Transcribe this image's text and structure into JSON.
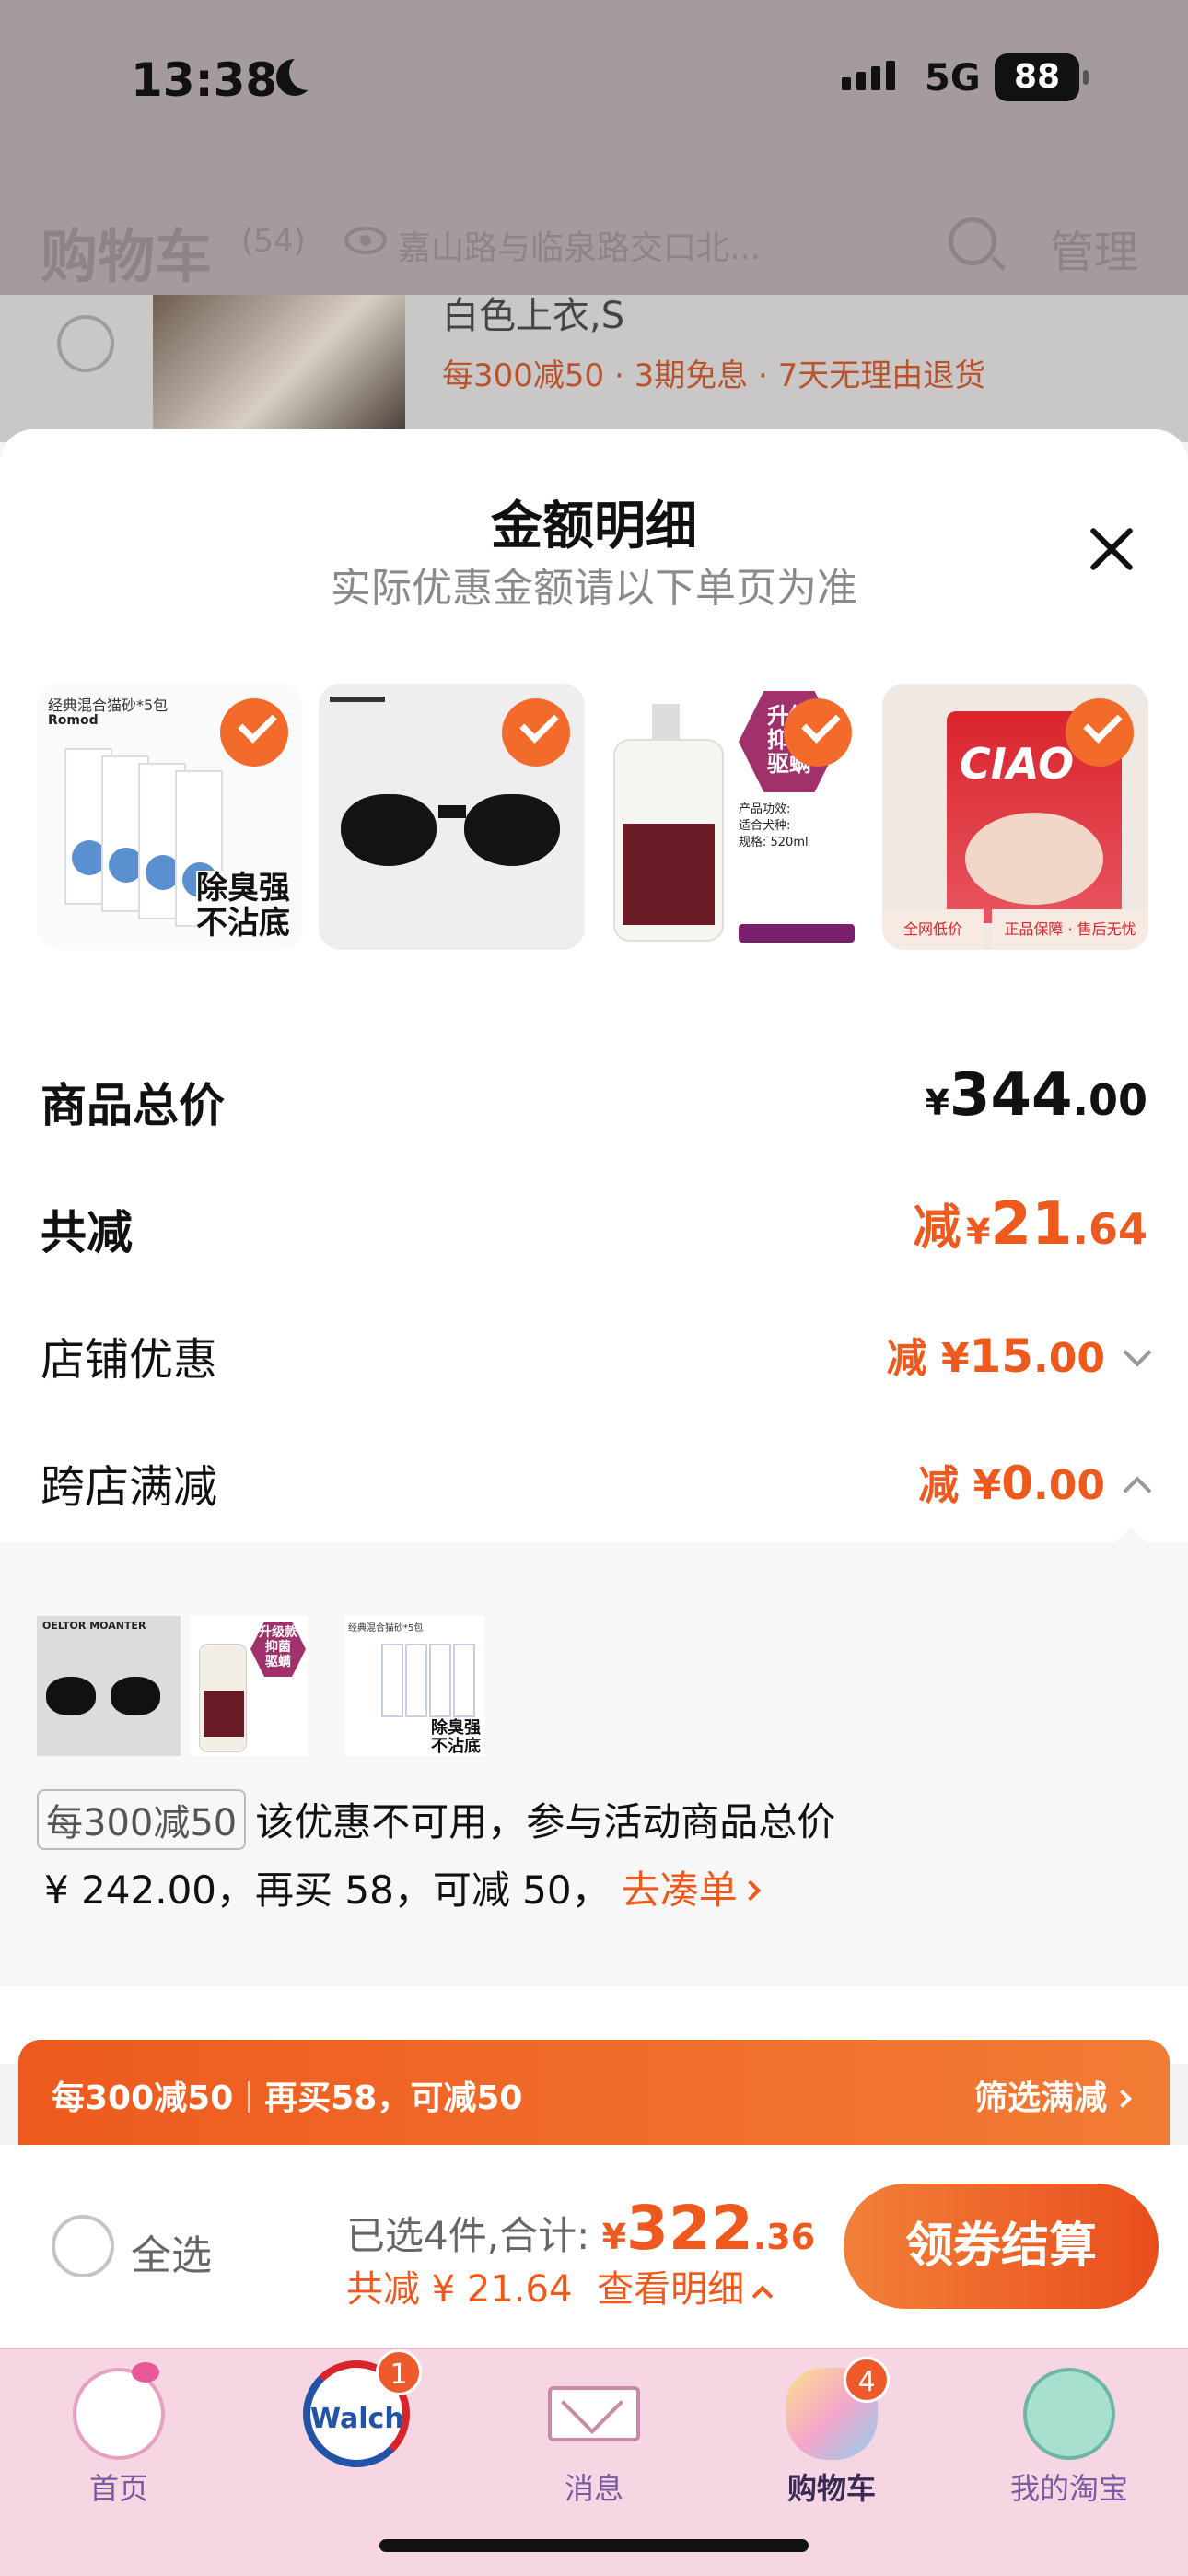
{
  "status_bar": {
    "time": "13:38",
    "network": "5G",
    "battery": "88"
  },
  "cart_header": {
    "title": "购物车",
    "count": "(54)",
    "address": "嘉山路与临泉路交口北...",
    "manage_label": "管理"
  },
  "background_item": {
    "spec": "白色上衣,S",
    "promo": "每300减50 · 3期免息 · 7天无理由退货"
  },
  "sheet": {
    "title": "金额明细",
    "subtitle": "实际优惠金额请以下单页为准",
    "products": [
      {
        "name": "cat-litter",
        "title": "经典混合猫砂*5包",
        "brand": "Romod",
        "label": "除臭强\n不沾底"
      },
      {
        "name": "sunglasses"
      },
      {
        "name": "pet-shampoo",
        "badge": "升级\n抑菌\n驱螨",
        "text": "产品功效:\n适合犬种:\n规格: 520ml"
      },
      {
        "name": "cat-food",
        "brand": "CIAO",
        "tag_left": "全网低价",
        "tag_right": "正品保障 · 售后无忧"
      }
    ],
    "total_price": {
      "label": "商品总价",
      "currency": "¥",
      "integer": "344",
      "decimal": ".00"
    },
    "total_discount": {
      "label": "共减",
      "prefix": "减",
      "currency": "¥",
      "integer": "21",
      "decimal": ".64"
    },
    "store_discount": {
      "label": "店铺优惠",
      "prefix": "减",
      "currency": "¥",
      "integer": "15",
      "decimal": ".00"
    },
    "cross_store": {
      "label": "跨店满减",
      "prefix": "减",
      "currency": "¥",
      "integer": "0",
      "decimal": ".00"
    },
    "promo_panel": {
      "mini_products": [
        {
          "name": "sunglasses",
          "brand": "OELTOR MOANTER"
        },
        {
          "name": "pet-shampoo",
          "badge": "升级款\n抑菌\n驱螨"
        },
        {
          "name": "cat-litter",
          "title": "经典混合猫砂*5包",
          "label": "除臭强\n不沾底"
        }
      ],
      "tag": "每300减50",
      "text1": "该优惠不可用，参与活动商品总价",
      "text2": "¥ 242.00，再买 58，可减 50，",
      "link": "去凑单"
    }
  },
  "banner": {
    "rule": "每300减50",
    "hint": "再买58，可减50",
    "action": "筛选满减"
  },
  "footer": {
    "select_all": "全选",
    "selected_text": "已选4件,合计:",
    "total_currency": "¥",
    "total_integer": "322",
    "total_decimal": ".36",
    "discount_text": "共减 ¥ 21.64",
    "detail_link": "查看明细",
    "checkout": "领券结算"
  },
  "tabbar": [
    {
      "label": "首页",
      "icon": "kitty-home-icon"
    },
    {
      "label": "Walch",
      "icon": "walch-icon",
      "badge": "1"
    },
    {
      "label": "消息",
      "icon": "mail-icon"
    },
    {
      "label": "购物车",
      "icon": "cart-bag-icon",
      "badge": "4",
      "active": true
    },
    {
      "label": "我的淘宝",
      "icon": "bear-profile-icon"
    }
  ],
  "colors": {
    "accent": "#EE5A1E",
    "tab_bg": "#F6D6E3",
    "overlay": "#A49AA0"
  }
}
